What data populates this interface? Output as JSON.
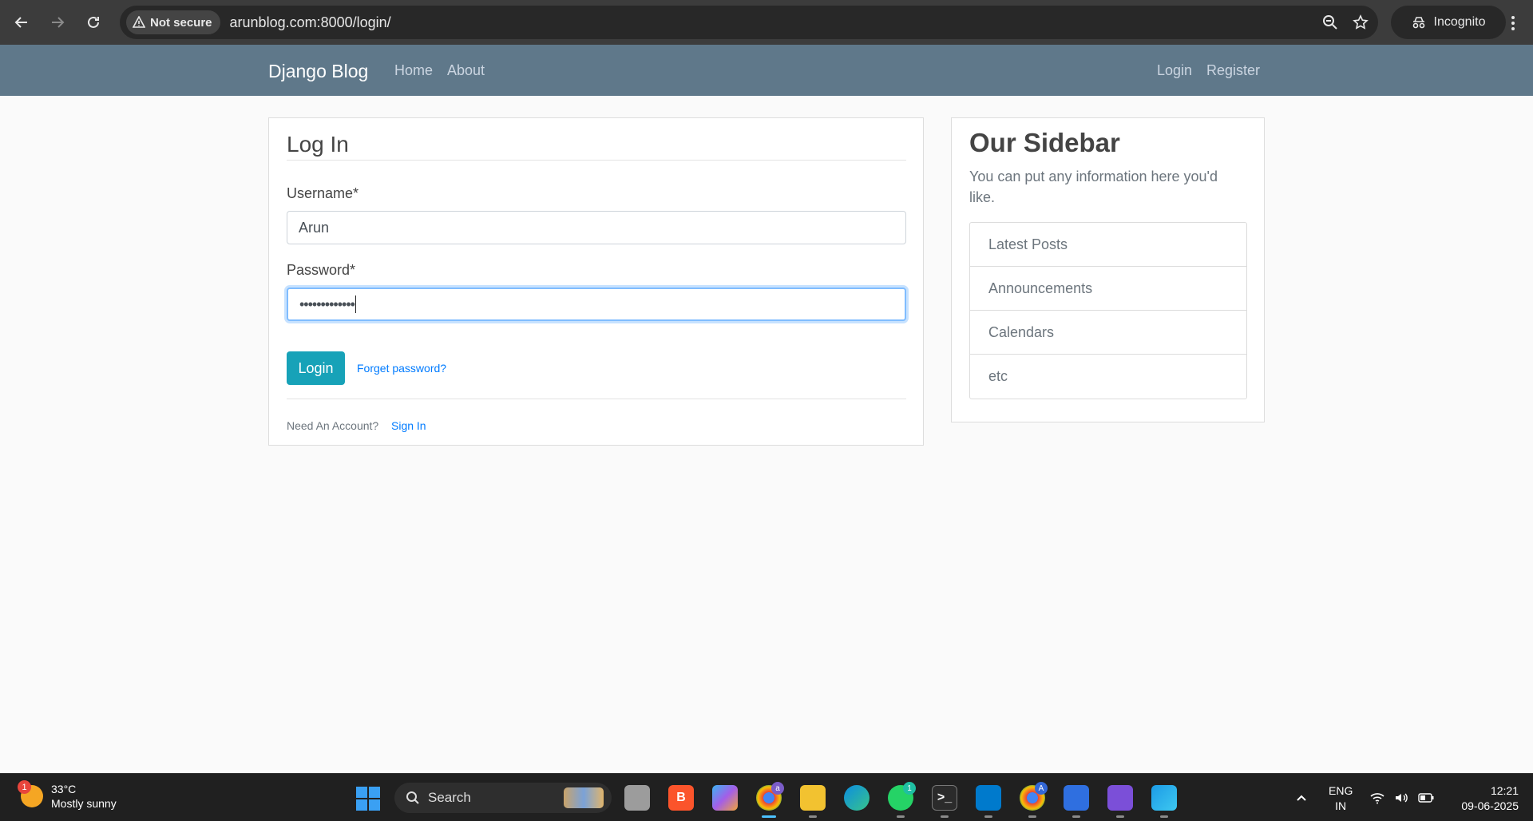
{
  "browser": {
    "security_label": "Not secure",
    "url": "arunblog.com:8000/login/",
    "profile_label": "Incognito"
  },
  "navbar": {
    "brand": "Django Blog",
    "left_links": [
      "Home",
      "About"
    ],
    "right_links": [
      "Login",
      "Register"
    ]
  },
  "login_form": {
    "title": "Log In",
    "username_label": "Username*",
    "username_value": "Arun",
    "password_label": "Password*",
    "password_value": "•••••••••••••",
    "submit_label": "Login",
    "forgot_link": "Forget password?",
    "footer_text": "Need An Account?",
    "footer_link": "Sign In"
  },
  "sidebar": {
    "title": "Our Sidebar",
    "text": "You can put any information here you'd like.",
    "items": [
      "Latest Posts",
      "Announcements",
      "Calendars",
      "etc"
    ]
  },
  "taskbar": {
    "weather_temp": "33°C",
    "weather_desc": "Mostly sunny",
    "weather_badge": "1",
    "search_label": "Search",
    "lang_line1": "ENG",
    "lang_line2": "IN",
    "time": "12:21",
    "date": "09-06-2025",
    "whatsapp_badge": "1",
    "chrome_badge": "a",
    "chrome2_badge": "A"
  },
  "colors": {
    "navbar_bg": "#5f788a",
    "button_info": "#17a2b8",
    "link": "#007bff"
  }
}
